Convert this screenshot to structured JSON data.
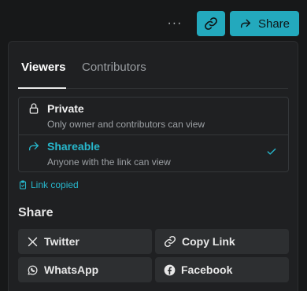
{
  "toolbar": {
    "more_label": "···",
    "share_label": "Share"
  },
  "tabs": [
    {
      "label": "Viewers",
      "active": true
    },
    {
      "label": "Contributors",
      "active": false
    }
  ],
  "visibility_options": [
    {
      "title": "Private",
      "description": "Only owner and contributors can view",
      "icon": "lock-icon",
      "selected": false
    },
    {
      "title": "Shareable",
      "description": "Anyone with the link can view",
      "icon": "share-arrow-icon",
      "selected": true
    }
  ],
  "status": {
    "link_copied": "Link copied",
    "icon": "clipboard-icon"
  },
  "share_section": {
    "heading": "Share",
    "buttons": [
      {
        "label": "Twitter",
        "icon": "x-logo-icon"
      },
      {
        "label": "Copy Link",
        "icon": "link-icon"
      },
      {
        "label": "WhatsApp",
        "icon": "whatsapp-icon"
      },
      {
        "label": "Facebook",
        "icon": "facebook-icon"
      }
    ]
  },
  "colors": {
    "accent": "#23a9bd",
    "background": "#171819",
    "panel": "#1f2022",
    "button": "#2d2f31"
  }
}
